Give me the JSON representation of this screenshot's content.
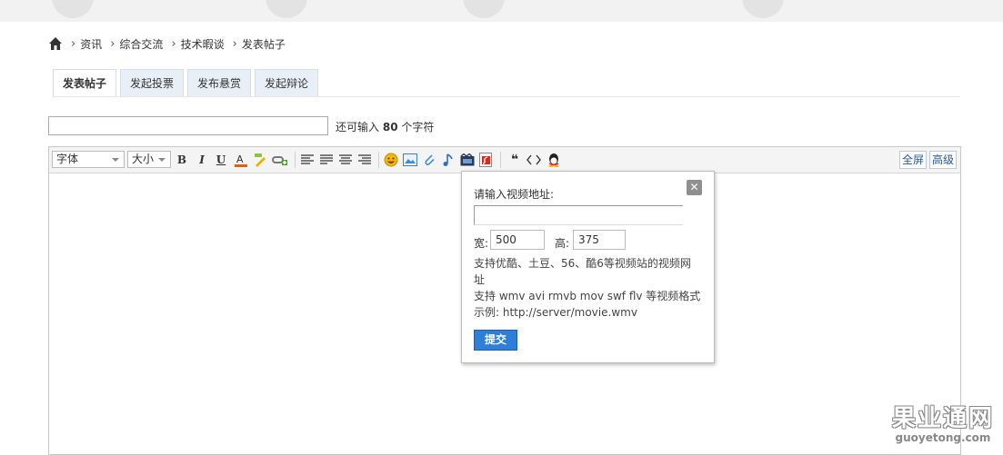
{
  "breadcrumb": {
    "items": [
      "资讯",
      "综合交流",
      "技术暇谈",
      "发表帖子"
    ]
  },
  "tabs": [
    {
      "label": "发表帖子",
      "active": true
    },
    {
      "label": "发起投票",
      "active": false
    },
    {
      "label": "发布悬赏",
      "active": false
    },
    {
      "label": "发起辩论",
      "active": false
    }
  ],
  "subject": {
    "value": "",
    "hint_prefix": "还可输入",
    "hint_count": "80",
    "hint_suffix": "个字符"
  },
  "toolbar": {
    "font_label": "字体",
    "size_label": "大小",
    "bold": "B",
    "italic": "I",
    "underline": "U",
    "fullscreen": "全屏",
    "advanced": "高级"
  },
  "video_popup": {
    "title": "请输入视频地址:",
    "url_value": "",
    "width_label": "宽:",
    "width_value": "500",
    "height_label": "高:",
    "height_value": "375",
    "desc1": "支持优酷、土豆、56、酷6等视频站的视频网址",
    "desc2": "支持 wmv avi rmvb mov swf flv 等视频格式",
    "desc3": "示例: http://server/movie.wmv",
    "submit": "提交"
  },
  "watermark": {
    "big": "果业通网",
    "small": "guoyetong.com"
  }
}
